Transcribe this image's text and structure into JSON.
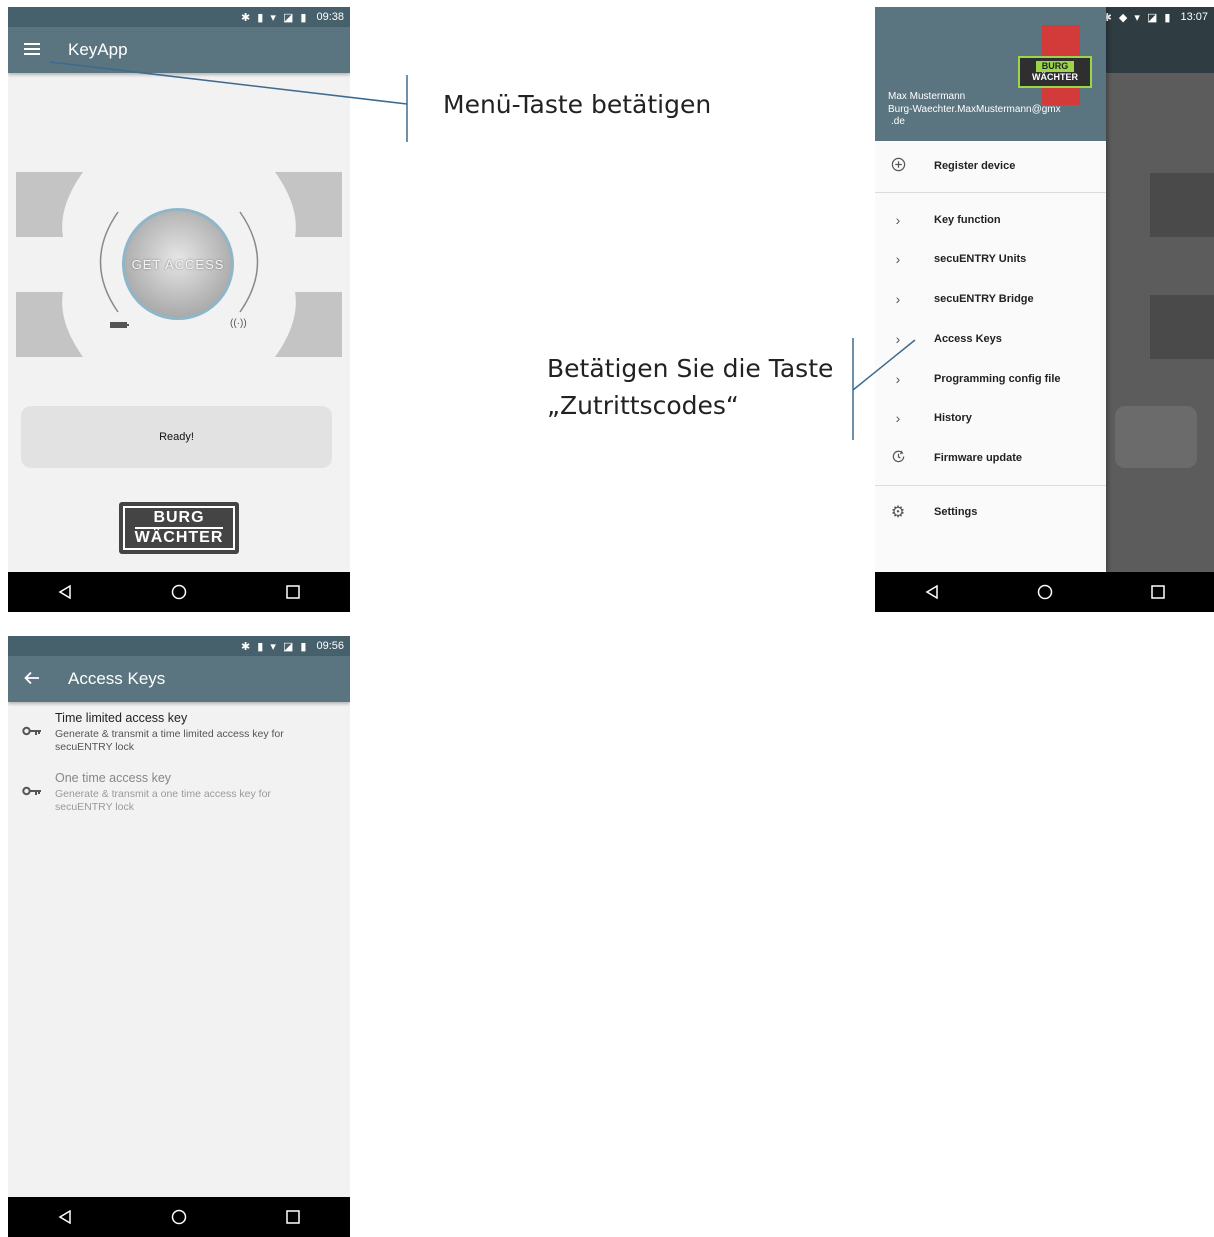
{
  "screen1": {
    "status_time": "09:38",
    "app_title": "KeyApp",
    "get_access_label": "GET ACCESS",
    "status_text": "Ready!",
    "logo_top": "BURG",
    "logo_bottom": "WÄCHTER"
  },
  "annotation1": "Menü-Taste betätigen",
  "screen2": {
    "status_time": "13:07",
    "user_name": "Max Mustermann",
    "user_email_line1": "Burg-Waechter.MaxMustermann@gmx",
    "user_email_line2": ".de",
    "logo_top": "BURG",
    "logo_bottom": "WÄCHTER",
    "menu": {
      "register": "Register device",
      "key_function": "Key function",
      "units": "secuENTRY Units",
      "bridge": "secuENTRY Bridge",
      "access_keys": "Access Keys",
      "programming": "Programming config file",
      "history": "History",
      "firmware": "Firmware update",
      "settings": "Settings"
    }
  },
  "annotation2": {
    "line1": "Betätigen Sie die Taste",
    "line2": "„Zutrittscodes“"
  },
  "screen3": {
    "status_time": "09:56",
    "app_title": "Access Keys",
    "items": [
      {
        "title": "Time limited access key",
        "sub1": "Generate & transmit a time limited access key for",
        "sub2": "secuENTRY lock"
      },
      {
        "title": "One time access key",
        "sub1": "Generate & transmit a one time access key for",
        "sub2": "secuENTRY lock"
      }
    ]
  },
  "colors": {
    "appbar": "#5a7580",
    "statusbar": "#46606c",
    "annotation_line": "#3d6a8e"
  },
  "icons": [
    "menu-icon",
    "back-arrow-icon",
    "key-icon",
    "plus-circle-icon",
    "chevron-right-icon",
    "history-icon",
    "gear-icon",
    "nav-back-icon",
    "nav-home-icon",
    "nav-recents-icon"
  ]
}
